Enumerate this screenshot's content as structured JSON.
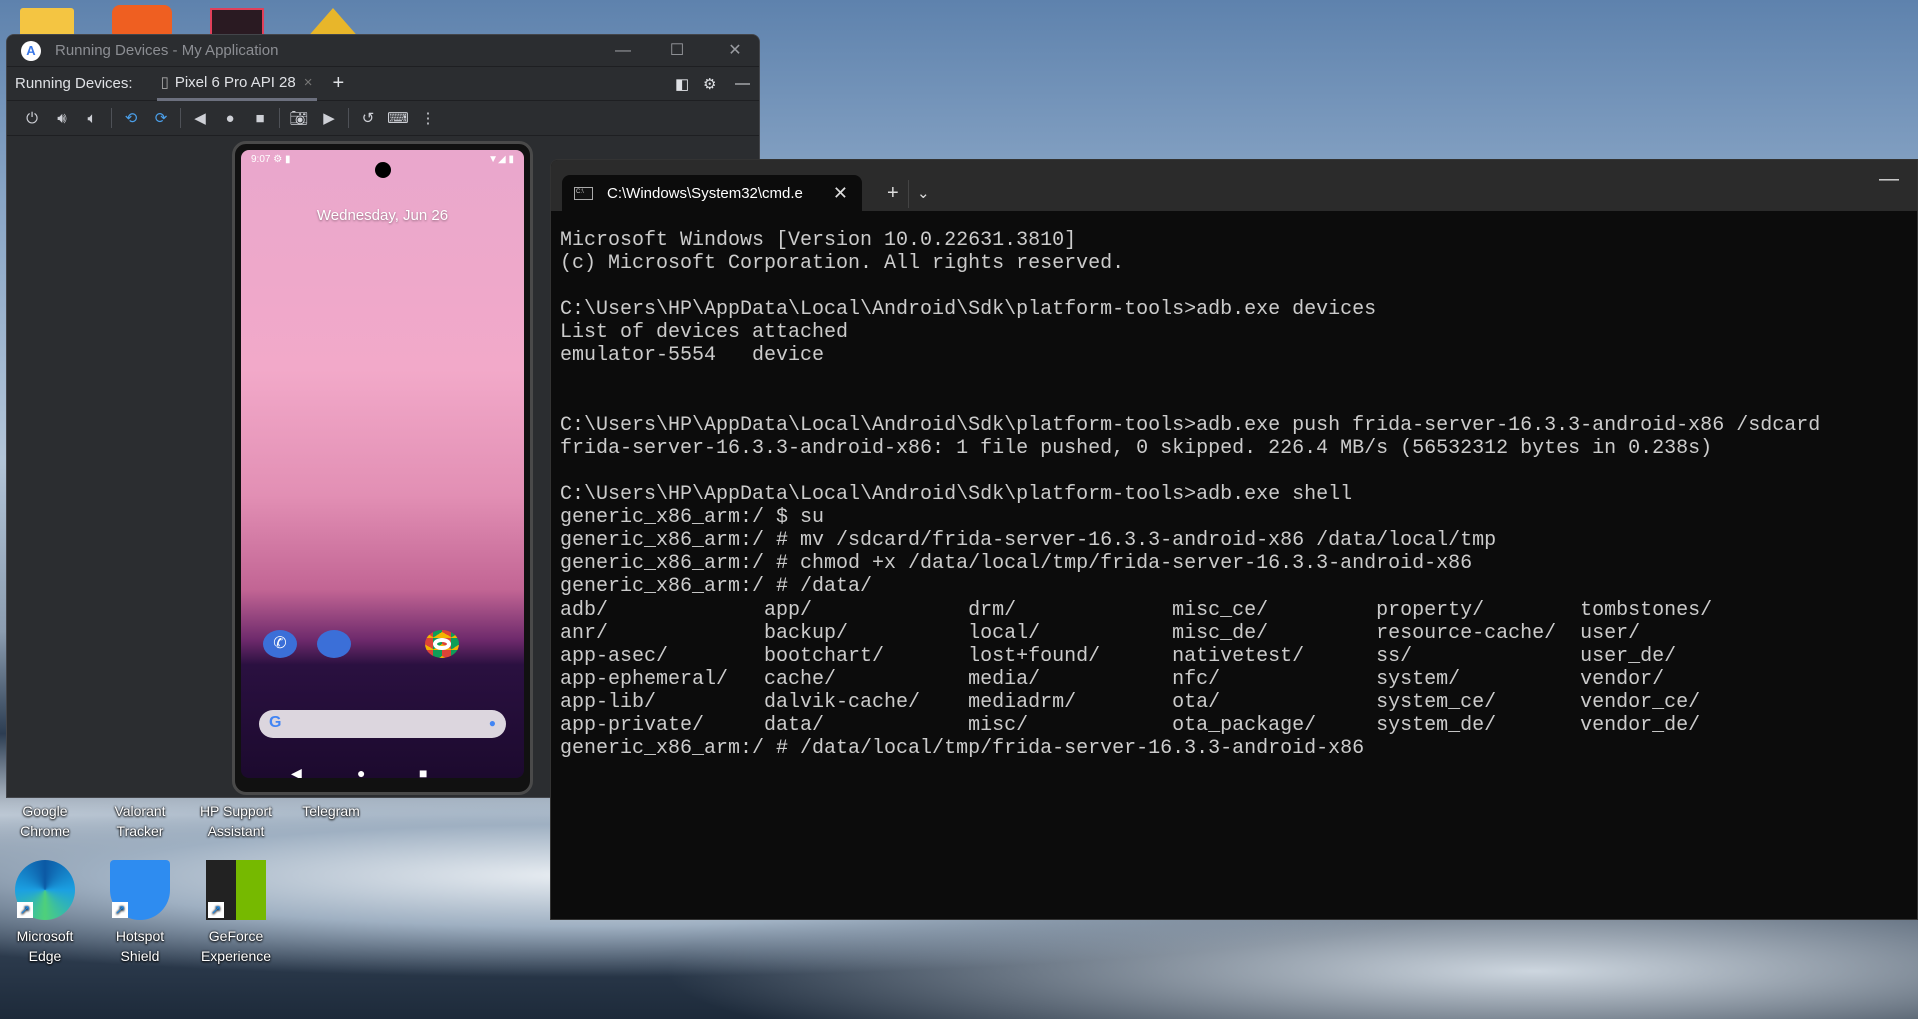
{
  "desktop": {
    "icons": [
      {
        "label": "Google Chrome",
        "l1": "Google",
        "l2": "Chrome"
      },
      {
        "label": "Valorant Tracker",
        "l1": "Valorant",
        "l2": "Tracker"
      },
      {
        "label": "HP Support Assistant",
        "l1": "HP Support",
        "l2": "Assistant"
      },
      {
        "label": "Telegram",
        "l1": "Telegram",
        "l2": ""
      },
      {
        "label": "Microsoft Edge",
        "l1": "Microsoft",
        "l2": "Edge"
      },
      {
        "label": "Hotspot Shield",
        "l1": "Hotspot",
        "l2": "Shield"
      },
      {
        "label": "GeForce Experience",
        "l1": "GeForce",
        "l2": "Experience"
      }
    ]
  },
  "studio": {
    "title": "Running Devices - My Application",
    "tabs_label": "Running Devices:",
    "device_tab": "Pixel 6 Pro API 28",
    "toolbar": [
      "power",
      "volume-up",
      "volume-down",
      "rotate-left",
      "rotate-right",
      "back",
      "home",
      "overview",
      "screenshot",
      "screen-record",
      "snapshot",
      "keyboard",
      "more"
    ]
  },
  "phone": {
    "time": "9:07",
    "date": "Wednesday, Jun 26"
  },
  "terminal": {
    "tab_title": "C:\\Windows\\System32\\cmd.e",
    "lines": [
      "Microsoft Windows [Version 10.0.22631.3810]",
      "(c) Microsoft Corporation. All rights reserved.",
      "",
      "C:\\Users\\HP\\AppData\\Local\\Android\\Sdk\\platform-tools>adb.exe devices",
      "List of devices attached",
      "emulator-5554   device",
      "",
      "",
      "C:\\Users\\HP\\AppData\\Local\\Android\\Sdk\\platform-tools>adb.exe push frida-server-16.3.3-android-x86 /sdcard",
      "frida-server-16.3.3-android-x86: 1 file pushed, 0 skipped. 226.4 MB/s (56532312 bytes in 0.238s)",
      "",
      "C:\\Users\\HP\\AppData\\Local\\Android\\Sdk\\platform-tools>adb.exe shell",
      "generic_x86_arm:/ $ su",
      "generic_x86_arm:/ # mv /sdcard/frida-server-16.3.3-android-x86 /data/local/tmp",
      "generic_x86_arm:/ # chmod +x /data/local/tmp/frida-server-16.3.3-android-x86",
      "generic_x86_arm:/ # /data/",
      "adb/             app/             drm/             misc_ce/         property/        tombstones/",
      "anr/             backup/          local/           misc_de/         resource-cache/  user/",
      "app-asec/        bootchart/       lost+found/      nativetest/      ss/              user_de/",
      "app-ephemeral/   cache/           media/           nfc/             system/          vendor/",
      "app-lib/         dalvik-cache/    mediadrm/        ota/             system_ce/       vendor_ce/",
      "app-private/     data/            misc/            ota_package/     system_de/       vendor_de/",
      "generic_x86_arm:/ # /data/local/tmp/frida-server-16.3.3-android-x86"
    ]
  }
}
